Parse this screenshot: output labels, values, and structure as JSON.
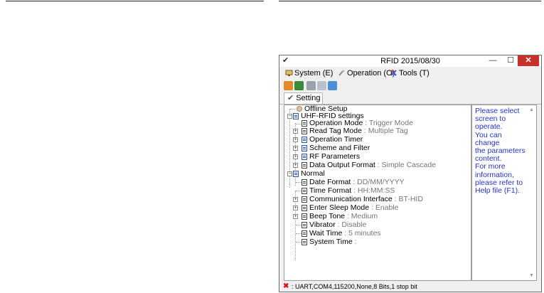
{
  "window": {
    "title": "RFID 2015/08/30",
    "controls": {
      "minimize": "—",
      "maximize": "☐",
      "close": "✕"
    }
  },
  "menu": [
    {
      "label": "System (E)",
      "icon": "system-icon"
    },
    {
      "label": "Operation (O)",
      "icon": "operation-icon"
    },
    {
      "label": "Tools (T)",
      "icon": "tools-icon"
    }
  ],
  "toolbar": [
    {
      "icon": "book-icon",
      "color": "#e08a2b"
    },
    {
      "icon": "reader-icon",
      "color": "#3a8a3a"
    },
    {
      "icon": "upload-icon",
      "color": "#9aa3ad"
    },
    {
      "icon": "print-icon",
      "color": "#b9c2cc"
    },
    {
      "icon": "refresh-icon",
      "color": "#4a90d9"
    }
  ],
  "tab": {
    "label": "Setting"
  },
  "tree": [
    {
      "label": "Offline Setup",
      "value": ""
    },
    {
      "label": "UHF-RFID settings",
      "value": ""
    },
    {
      "label": "Operation Mode",
      "value": ": Trigger Mode"
    },
    {
      "label": "Read Tag Mode",
      "value": ": Multiple Tag"
    },
    {
      "label": "Operation Timer",
      "value": ""
    },
    {
      "label": "Scheme and Filter",
      "value": ""
    },
    {
      "label": "RF Parameters",
      "value": ""
    },
    {
      "label": "Data Output Format",
      "value": ": Simple Cascade"
    },
    {
      "label": "Normal",
      "value": ""
    },
    {
      "label": "Date Format",
      "value": ": DD/MM/YYYY"
    },
    {
      "label": "Time Format",
      "value": ": HH:MM:SS"
    },
    {
      "label": "Communication Interface",
      "value": ": BT-HID"
    },
    {
      "label": "Enter Sleep Mode",
      "value": ": Enable"
    },
    {
      "label": "Beep Tone",
      "value": ": Medium"
    },
    {
      "label": "Vibrator",
      "value": ": Disable"
    },
    {
      "label": "Wait Time",
      "value": ": 5 minutes"
    },
    {
      "label": "System Time",
      "value": ":"
    }
  ],
  "help": {
    "lines": [
      "Please select",
      "screen to operate.",
      "You can change",
      "the parameters",
      "content.",
      "For more",
      "information,",
      "please refer to",
      "Help file (F1)."
    ]
  },
  "status": {
    "text": ": UART,COM4,115200,None,8 Bits,1 stop bit"
  },
  "colors": {
    "help_text": "#2233cc",
    "close_button": "#c9302c",
    "status_x": "#dd1111"
  }
}
